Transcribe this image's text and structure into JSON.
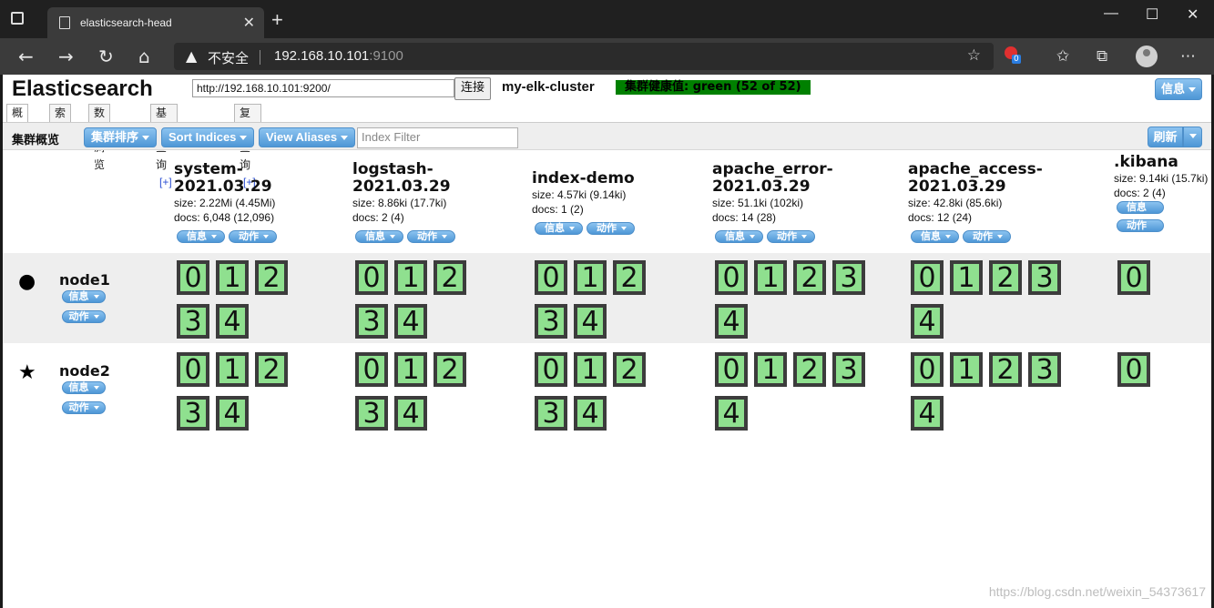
{
  "browser": {
    "tab_title": "elasticsearch-head",
    "insecure_label": "不安全",
    "url_host": "192.168.10.101",
    "url_port": ":9100",
    "ext_badge": "0"
  },
  "header": {
    "logo": "Elasticsearch",
    "connect_url": "http://192.168.10.101:9200/",
    "connect_label": "连接",
    "cluster_name": "my-elk-cluster",
    "health": "集群健康值: green (52 of 52)",
    "info_label": "信息"
  },
  "tabs": [
    {
      "label": "概览",
      "plus": ""
    },
    {
      "label": "索引",
      "plus": ""
    },
    {
      "label": "数据浏览",
      "plus": ""
    },
    {
      "label": "基本查询",
      "plus": "[+]"
    },
    {
      "label": "复合查询",
      "plus": "[+]"
    }
  ],
  "toolbar": {
    "title": "集群概览",
    "sort_cluster": "集群排序",
    "sort_indices": "Sort Indices",
    "view_aliases": "View Aliases",
    "filter_placeholder": "Index Filter",
    "refresh": "刷新"
  },
  "buttons": {
    "info": "信息",
    "action": "动作"
  },
  "indices": [
    {
      "name1": "system-",
      "name2": "2021.03.29",
      "size": "size: 2.22Mi (4.45Mi)",
      "docs": "docs: 6,048 (12,096)",
      "shards": [
        "0",
        "1",
        "2",
        "3",
        "4"
      ]
    },
    {
      "name1": "logstash-",
      "name2": "2021.03.29",
      "size": "size: 8.86ki (17.7ki)",
      "docs": "docs: 2 (4)",
      "shards": [
        "0",
        "1",
        "2",
        "3",
        "4"
      ]
    },
    {
      "name1": "index-demo",
      "name2": "",
      "size": "size: 4.57ki (9.14ki)",
      "docs": "docs: 1 (2)",
      "shards": [
        "0",
        "1",
        "2",
        "3",
        "4"
      ]
    },
    {
      "name1": "apache_error-",
      "name2": "2021.03.29",
      "size": "size: 51.1ki (102ki)",
      "docs": "docs: 14 (28)",
      "shards": [
        "0",
        "1",
        "2",
        "3",
        "4"
      ]
    },
    {
      "name1": "apache_access-",
      "name2": "2021.03.29",
      "size": "size: 42.8ki (85.6ki)",
      "docs": "docs: 12 (24)",
      "shards": [
        "0",
        "1",
        "2",
        "3",
        "4"
      ]
    },
    {
      "name1": ".kibana",
      "name2": "",
      "size": "size: 9.14ki (15.7ki)",
      "docs": "docs: 2 (4)",
      "shards": [
        "0"
      ]
    }
  ],
  "nodes": [
    {
      "name": "node1",
      "marker": "●"
    },
    {
      "name": "node2",
      "marker": "★"
    }
  ],
  "watermark": "https://blog.csdn.net/weixin_54373617"
}
